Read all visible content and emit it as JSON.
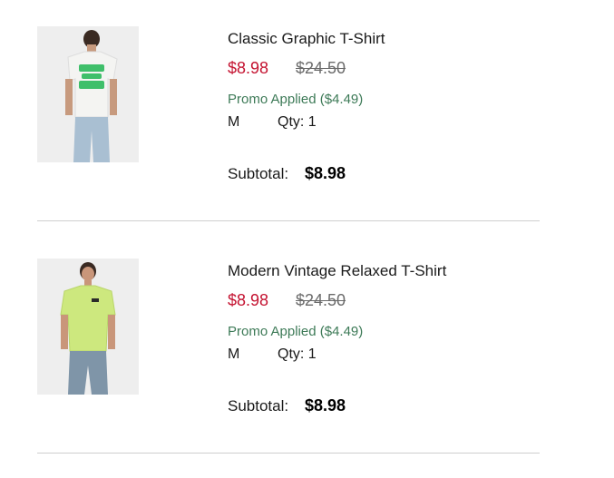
{
  "cart": {
    "items": [
      {
        "name": "Classic Graphic T-Shirt",
        "sale_price": "$8.98",
        "original_price": "$24.50",
        "promo": "Promo Applied ($4.49)",
        "size": "M",
        "qty": "Qty: 1",
        "subtotal_label": "Subtotal:",
        "subtotal_value": "$8.98",
        "image": {
          "icon": "product-photo-white-graphic-tee-back",
          "shirt_color": "#f4f4f2",
          "graphic_color": "#3fbf6a"
        }
      },
      {
        "name": "Modern Vintage Relaxed T-Shirt",
        "sale_price": "$8.98",
        "original_price": "$24.50",
        "promo": "Promo Applied ($4.49)",
        "size": "M",
        "qty": "Qty: 1",
        "subtotal_label": "Subtotal:",
        "subtotal_value": "$8.98",
        "image": {
          "icon": "product-photo-lime-tee-front",
          "shirt_color": "#cde87e"
        }
      }
    ]
  },
  "colors": {
    "sale": "#c41230",
    "promo": "#3d7a57",
    "strikethrough": "#6b6b6b",
    "divider": "#cfcfcf"
  }
}
